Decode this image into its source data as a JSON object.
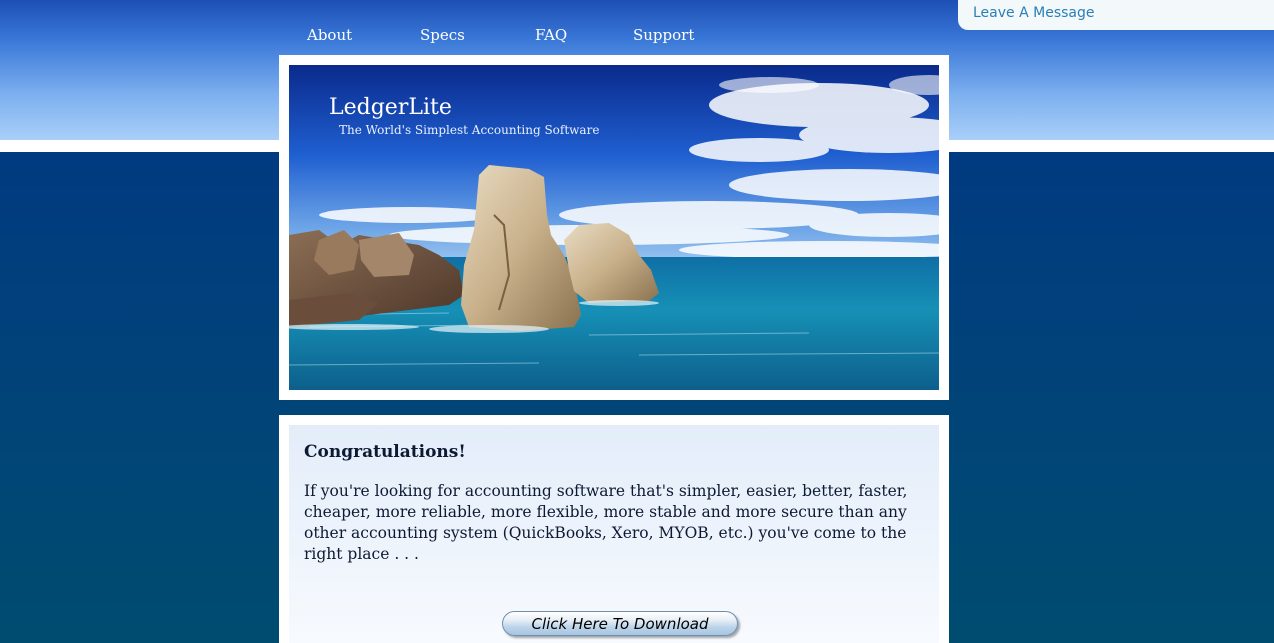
{
  "nav": {
    "items": [
      {
        "label": "About"
      },
      {
        "label": "Specs"
      },
      {
        "label": "FAQ"
      },
      {
        "label": "Support"
      }
    ]
  },
  "message_tab": {
    "label": "Leave A Message"
  },
  "banner": {
    "title": "LedgerLite",
    "tagline": "The World's Simplest Accounting Software"
  },
  "content": {
    "heading": "Congratulations!",
    "body": "If you're looking for accounting software that's simpler, easier, better, faster, cheaper, more reliable, more flexible, more stable and more secure than any other accounting system (QuickBooks, Xero, MYOB, etc.) you've come to the right place . . .",
    "download_label": "Click Here To Download"
  },
  "colors": {
    "nav_text": "#ffffff",
    "message_link": "#2a7fb6",
    "body_text": "#0d1a33"
  }
}
